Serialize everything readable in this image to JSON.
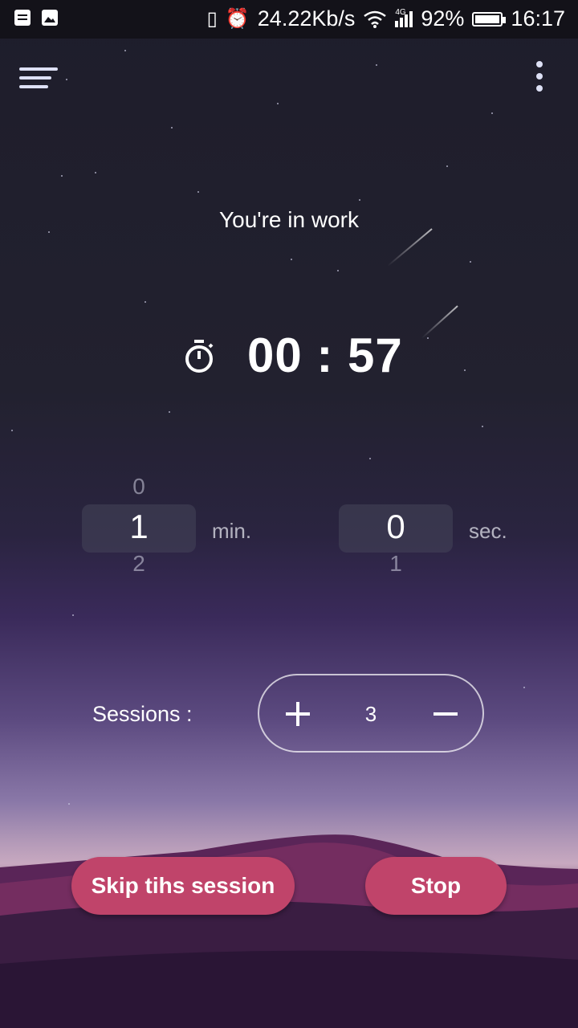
{
  "status_bar": {
    "speed": "24.22Kb/s",
    "network": "4G",
    "battery": "92%",
    "time": "16:17"
  },
  "session": {
    "status_title": "You're in work",
    "timer": "00 : 57"
  },
  "pickers": {
    "minutes": {
      "above": "0",
      "selected": "1",
      "below": "2",
      "unit": "min."
    },
    "seconds": {
      "above": "",
      "selected": "0",
      "below": "1",
      "unit": "sec."
    }
  },
  "sessions": {
    "label": "Sessions :",
    "count": "3"
  },
  "buttons": {
    "skip": "Skip tihs session",
    "stop": "Stop"
  },
  "colors": {
    "accent": "#c0446a",
    "background": "#1e1d2b"
  }
}
